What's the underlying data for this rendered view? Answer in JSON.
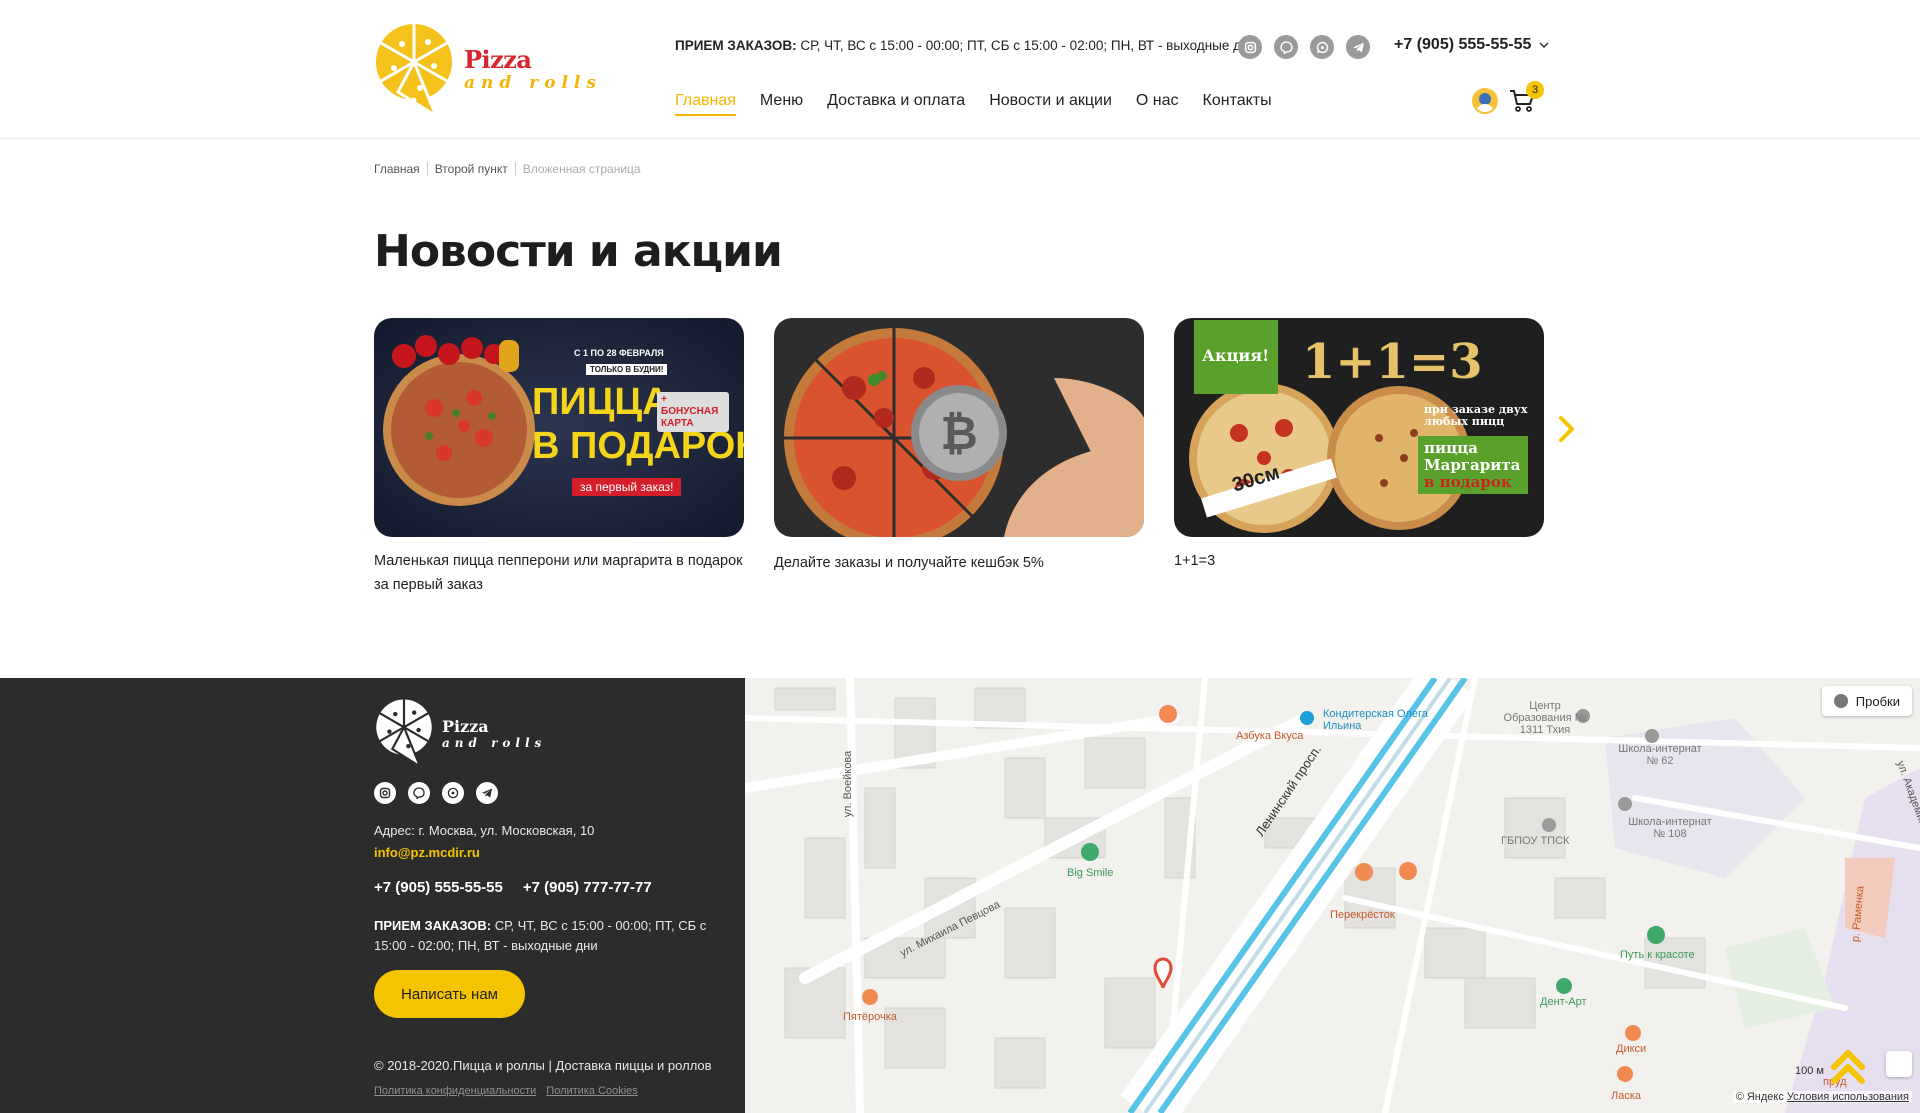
{
  "brand": {
    "name_line1": "Pizza",
    "name_line2": "and rolls"
  },
  "header": {
    "hours_label": "ПРИЕМ ЗАКАЗОВ:",
    "hours_text": "СР, ЧТ, ВС с 15:00 - 00:00; ПТ, СБ с 15:00 - 02:00; ПН, ВТ - выходные дни",
    "phone": "+7 (905) 555-55-55",
    "social_icons": [
      "instagram-icon",
      "viber-icon",
      "whatsapp-icon",
      "telegram-icon"
    ],
    "nav": [
      {
        "label": "Главная",
        "active": true
      },
      {
        "label": "Меню"
      },
      {
        "label": "Доставка и оплата"
      },
      {
        "label": "Новости и акции"
      },
      {
        "label": "О нас"
      },
      {
        "label": "Контакты"
      }
    ],
    "cart_count": "3"
  },
  "breadcrumb": [
    "Главная",
    "Второй пункт",
    "Вложенная страница"
  ],
  "page_title": "Новости и акции",
  "news": [
    {
      "caption": "Маленькая пицца пепперони или маргарита в подарок за первый заказ",
      "banner": {
        "period": "С 1 ПО 28 ФЕВРАЛЯ",
        "weekdays": "ТОЛЬКО В БУДНИ!",
        "headline_1": "ПИЦЦА",
        "headline_2": "В ПОДАРОК",
        "bonus": "+ БОНУСНАЯ КАРТА",
        "first_order": "за первый заказ!"
      }
    },
    {
      "caption": "Делайте заказы и получайте кешбэк 5%"
    },
    {
      "caption": "1+1=3",
      "banner": {
        "tag": "Акция!",
        "formula": "1+1=3",
        "size": "30см",
        "condition": "при заказе двух любых пицц",
        "gift_1": "пицца",
        "gift_2": "Маргарита",
        "gift_3": "в подарок"
      }
    }
  ],
  "footer": {
    "address": "Адрес: г. Москва, ул. Московская, 10",
    "email": "info@pz.mcdir.ru",
    "phone_1": "+7 (905) 555-55-55",
    "phone_2": "+7 (905) 777-77-77",
    "hours_label": "ПРИЕМ ЗАКАЗОВ:",
    "hours_text": "СР, ЧТ, ВС с 15:00 - 00:00; ПТ, СБ с 15:00 - 02:00; ПН, ВТ - выходные дни",
    "write_button": "Написать нам",
    "copyright": "© 2018-2020.Пицца и роллы | Доставка пиццы и роллов",
    "privacy": "Политика конфиденциальности",
    "cookies": "Политика Cookies"
  },
  "map": {
    "traffic_button": "Пробки",
    "copyright": "© Яндекс",
    "terms": "Условия использования",
    "scale": "100 м",
    "labels": {
      "leninsky": "Ленинский просп.",
      "mikhaila": "ул. Михаила Певцова",
      "voeikova": "ул. Воейкова",
      "akademika": "ул. Академика Пи",
      "ramenka": "р. Раменка",
      "azbuka": "Азбука Вкуса",
      "konditerskaya": "Кондитерская Олега Ильина",
      "center": "Центр Образования № 1311 Тхия",
      "school62": "Школа-интернат № 62",
      "school108": "Школа-интернат № 108",
      "gbpou": "ГБПОУ ТПСК",
      "bigsmile": "Big Smile",
      "perekrestok": "Перекрёсток",
      "put": "Путь к красоте",
      "dentart": "Дент-Арт",
      "pyaterochka": "Пятёрочка",
      "diksi": "Дикси",
      "laska": "Ласка",
      "prud": "пруд"
    }
  }
}
